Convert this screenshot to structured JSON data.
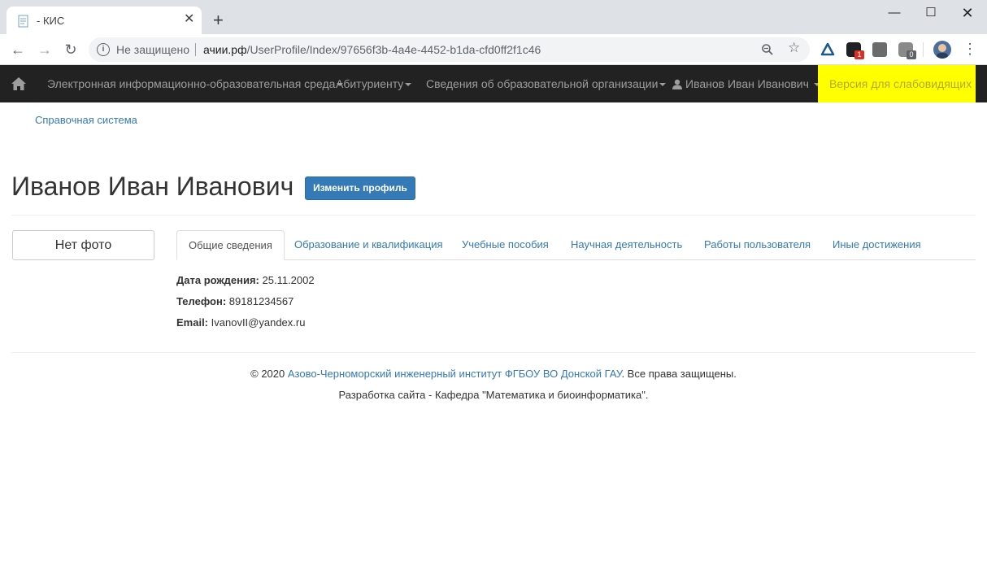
{
  "browser": {
    "tab_title": "- КИС",
    "not_secure_label": "Не защищено",
    "url_host": "ачии.рф",
    "url_path": "/UserProfile/Index/97656f3b-4a4e-4452-b1da-cfd0ff2f1c46",
    "extension_badge_1": "1",
    "extension_badge_2": "0"
  },
  "navbar": {
    "items": [
      {
        "label": "Электронная информационно-образовательная среда"
      },
      {
        "label": "Абитуриенту"
      },
      {
        "label": "Сведения об образовательной организации"
      }
    ],
    "user_label": "Иванов Иван Иванович",
    "accessible_version": "Версия для слабовидящих",
    "background": "#222222",
    "accessible_bg": "#ffff00"
  },
  "page": {
    "help_link": "Справочная система",
    "profile_name": "Иванов Иван Иванович",
    "edit_button": "Изменить профиль",
    "no_photo": "Нет фото",
    "tabs": [
      {
        "label": "Общие сведения",
        "active": true
      },
      {
        "label": "Образование и квалификация"
      },
      {
        "label": "Учебные пособия"
      },
      {
        "label": "Научная деятельность"
      },
      {
        "label": "Работы пользователя"
      },
      {
        "label": "Иные достижения"
      }
    ],
    "info": {
      "birth_label": "Дата рождения:",
      "birth_value": "25.11.2002",
      "phone_label": "Телефон:",
      "phone_value": "89181234567",
      "email_label": "Email:",
      "email_value": "IvanovII@yandex.ru"
    },
    "accent_color": "#337ab7"
  },
  "footer": {
    "copyright_prefix": "© 2020 ",
    "institute_link": "Азово-Черноморский инженерный институт ФГБОУ ВО Донской ГАУ",
    "copyright_suffix": ". Все права защищены.",
    "dev_line": "Разработка сайта - Кафедра \"Математика и биоинформатика\"."
  }
}
